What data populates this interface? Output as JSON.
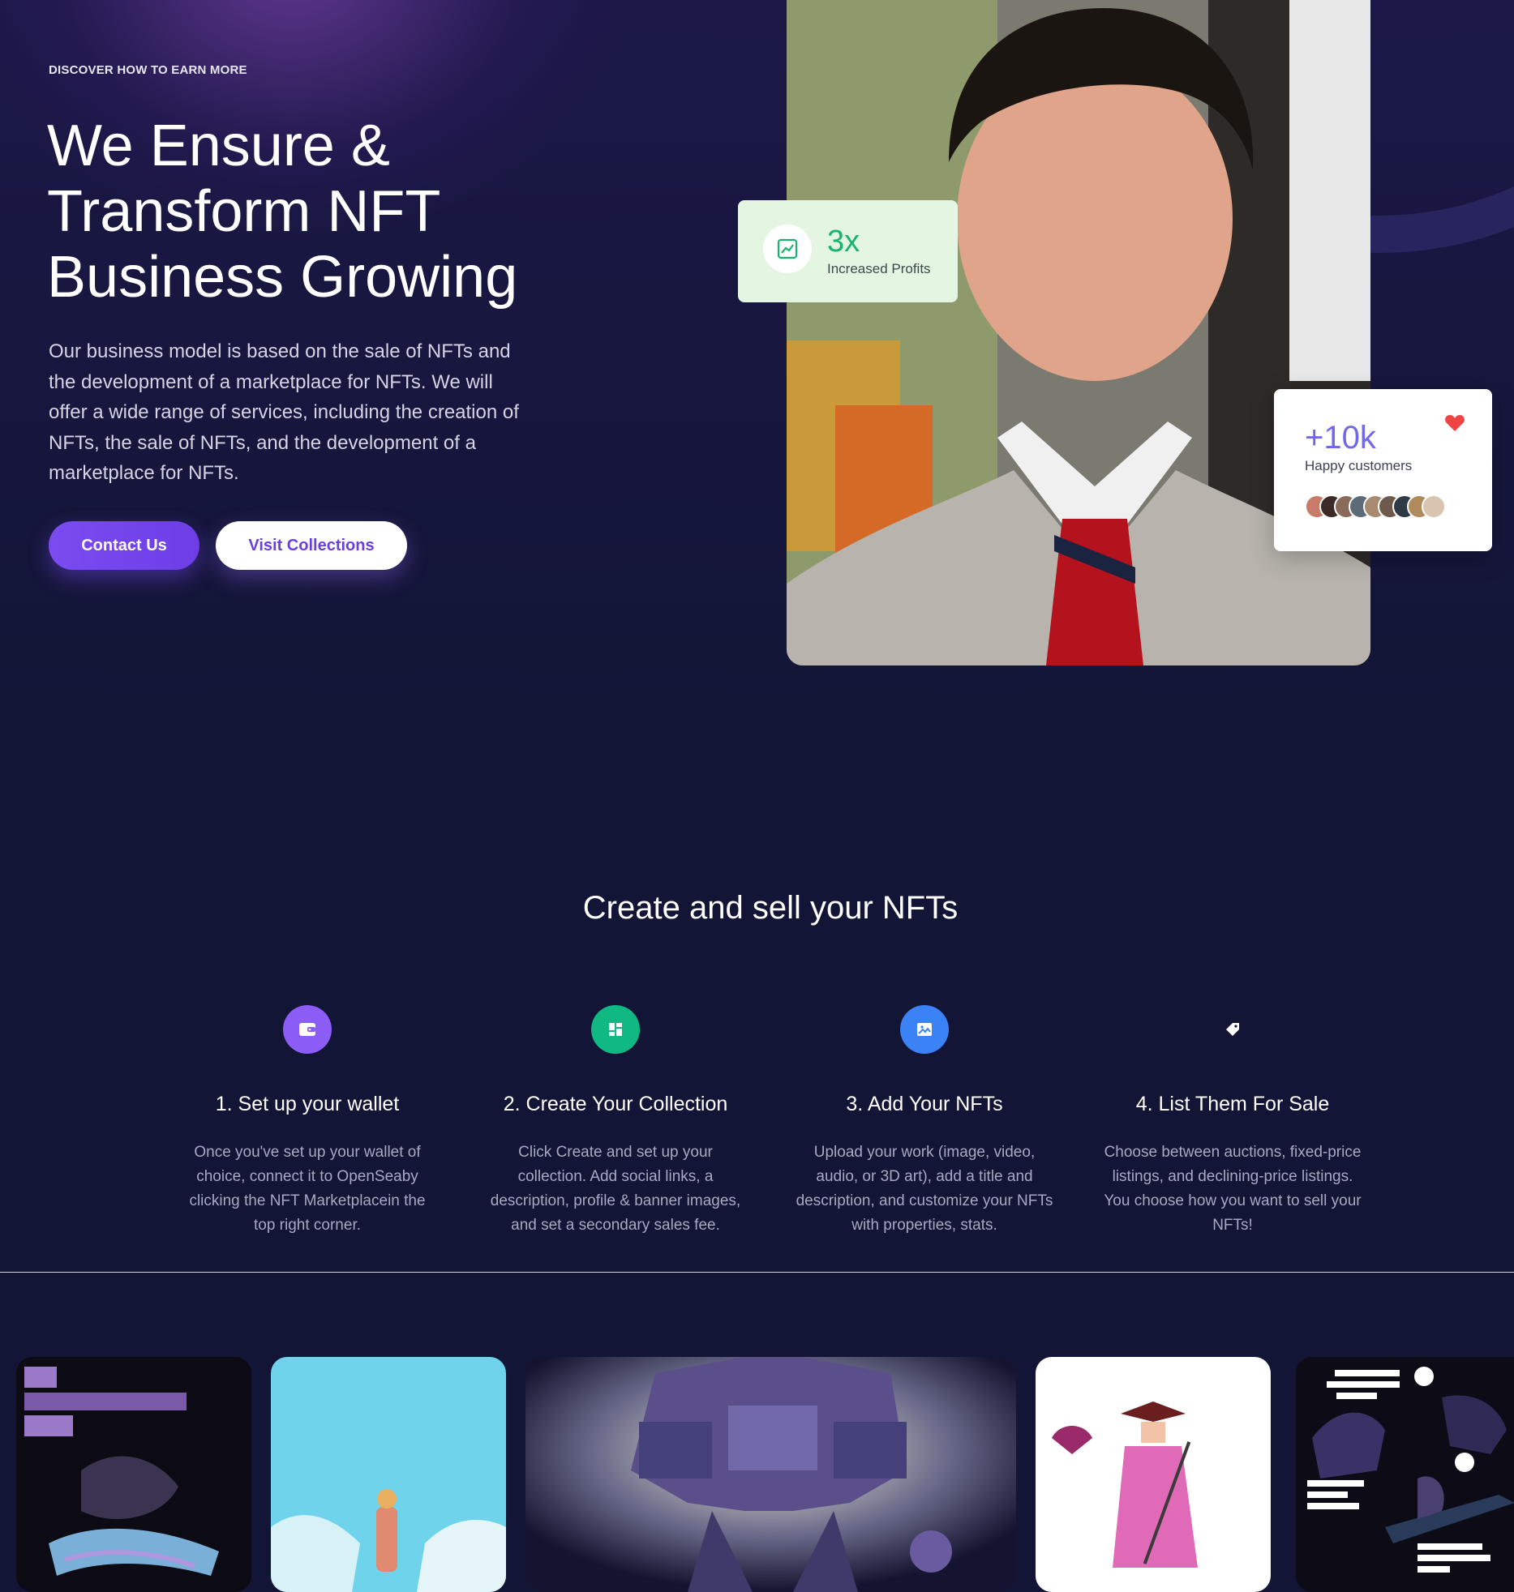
{
  "hero": {
    "eyebrow": "DISCOVER HOW TO EARN MORE",
    "title": "We Ensure & Transform NFT Business Growing",
    "description": "Our business model is based on the sale of NFTs and the development of a marketplace for NFTs. We will offer a wide range of services, including the creation of NFTs, the sale of NFTs, and the development of a marketplace for NFTs.",
    "contact_label": "Contact Us",
    "visit_label": "Visit Collections"
  },
  "stats": {
    "profit_value": "3x",
    "profit_label": "Increased Profits",
    "customers_value": "+10k",
    "customers_label": "Happy customers"
  },
  "steps": {
    "title": "Create and sell your NFTs",
    "items": [
      {
        "title": "1. Set up your wallet",
        "desc": "Once you've set up your wallet of choice, connect it to OpenSeaby clicking the NFT Marketplacein the top right corner.",
        "icon": "wallet-icon",
        "color": "#8b5cf6"
      },
      {
        "title": "2. Create Your Collection",
        "desc": "Click Create and set up your collection. Add social links, a description, profile & banner images, and set a secondary sales fee.",
        "icon": "grid-icon",
        "color": "#10b981"
      },
      {
        "title": "3. Add Your NFTs",
        "desc": "Upload your work (image, video, audio, or 3D art), add a title and description, and customize your NFTs with properties, stats.",
        "icon": "image-icon",
        "color": "#3b82f6"
      },
      {
        "title": "4. List Them For Sale",
        "desc": "Choose between auctions, fixed-price listings, and declining-price listings. You choose how you want to sell your NFTs!",
        "icon": "tag-icon",
        "color": "#121535"
      }
    ]
  }
}
